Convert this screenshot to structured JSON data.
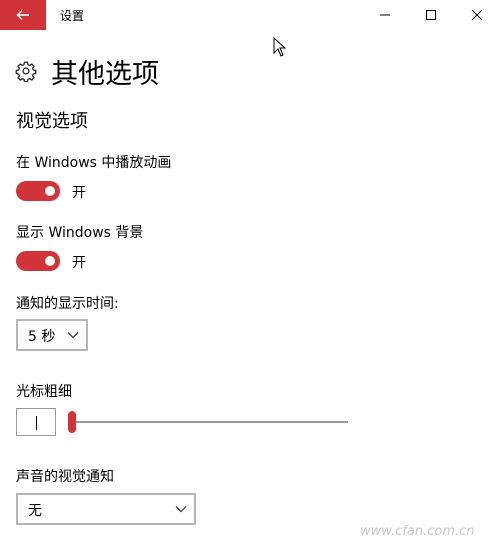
{
  "window": {
    "title": "设置"
  },
  "page": {
    "title": "其他选项"
  },
  "visual": {
    "section_title": "视觉选项",
    "animations": {
      "label": "在 Windows 中播放动画",
      "state": "开",
      "on": true
    },
    "background": {
      "label": "显示 Windows 背景",
      "state": "开",
      "on": true
    },
    "notification_time": {
      "label": "通知的显示时间:",
      "value": "5 秒"
    },
    "cursor_thickness": {
      "label": "光标粗细",
      "value": "|",
      "level": 0
    },
    "sound_notification": {
      "label": "声音的视觉通知",
      "value": "无"
    }
  },
  "watermark": "www.cfan.com.cn",
  "colors": {
    "accent": "#d13438",
    "text": "#000000",
    "border": "#b5b5b5",
    "track": "#999999"
  },
  "icons": [
    "back-arrow-icon",
    "minimize-icon",
    "maximize-icon",
    "close-icon",
    "gear-icon",
    "chevron-down-icon"
  ]
}
